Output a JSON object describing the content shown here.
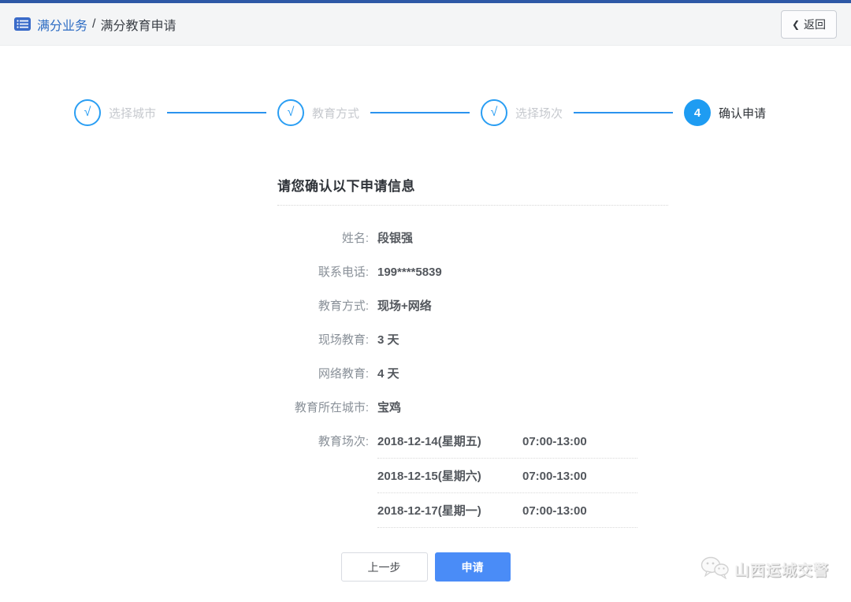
{
  "colors": {
    "top_accent": "#2d58a6",
    "header_bg": "#f4f5f6",
    "brand_blue": "#2b6bc3",
    "stepper_blue": "#2a9ef3",
    "apply_button_blue": "#4a8cf7"
  },
  "header": {
    "breadcrumb_primary": "满分业务",
    "breadcrumb_separator": "/",
    "breadcrumb_secondary": "满分教育申请",
    "back_button": {
      "chevron": "❮",
      "label": "返回"
    }
  },
  "stepper": {
    "steps": [
      {
        "label": "选择城市",
        "mark": "√",
        "status": "done"
      },
      {
        "label": "教育方式",
        "mark": "√",
        "status": "done"
      },
      {
        "label": "选择场次",
        "mark": "√",
        "status": "done"
      },
      {
        "label": "确认申请",
        "mark": "4",
        "status": "active"
      }
    ]
  },
  "form": {
    "title": "请您确认以下申请信息",
    "fields": [
      {
        "label": "姓名:",
        "value": "段银强"
      },
      {
        "label": "联系电话:",
        "value": "199****5839"
      },
      {
        "label": "教育方式:",
        "value": "现场+网络"
      },
      {
        "label": "现场教育:",
        "value": "3 天"
      },
      {
        "label": "网络教育:",
        "value": "4 天"
      },
      {
        "label": "教育所在城市:",
        "value": "宝鸡"
      }
    ],
    "sessions_label": "教育场次:",
    "sessions": [
      {
        "date": "2018-12-14(星期五)",
        "time": "07:00-13:00"
      },
      {
        "date": "2018-12-15(星期六)",
        "time": "07:00-13:00"
      },
      {
        "date": "2018-12-17(星期一)",
        "time": "07:00-13:00"
      }
    ]
  },
  "actions": {
    "prev_label": "上一步",
    "apply_label": "申请"
  },
  "watermark": {
    "text": "山西运城交警",
    "icon": "wechat-icon"
  }
}
